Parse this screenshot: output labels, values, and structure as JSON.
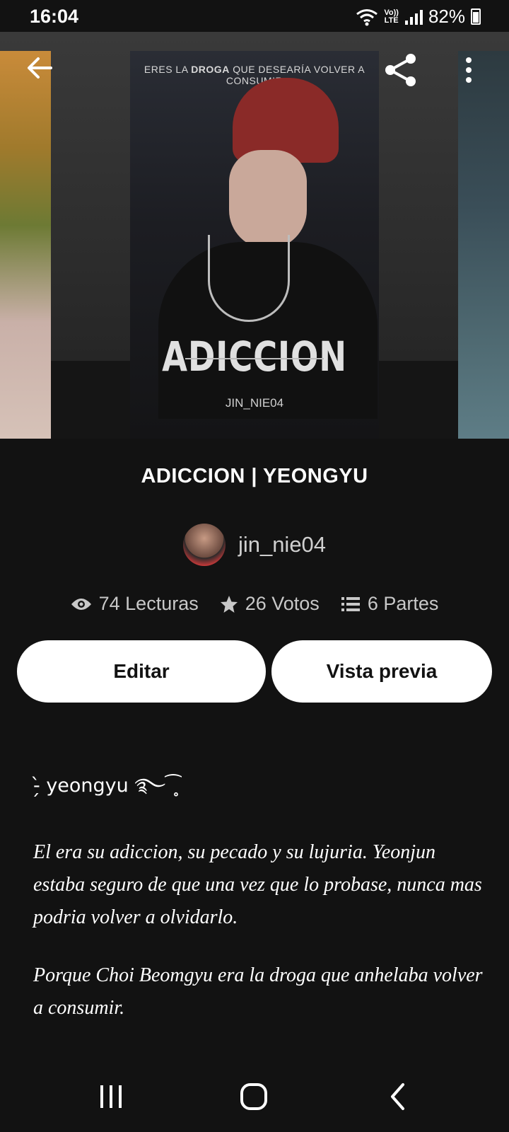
{
  "status_bar": {
    "time": "16:04",
    "network_top": "Vo))",
    "network_bottom": "LTE",
    "battery": "82%"
  },
  "cover": {
    "tagline_prefix": "ERES LA ",
    "tagline_bold": "DROGA",
    "tagline_suffix": " QUE DESEARÍA VOLVER A CONSUMIR",
    "title": "ADICCION",
    "author": "JIN_NIE04"
  },
  "story": {
    "title": "ADICCION | YEONGYU",
    "author": "jin_nie04"
  },
  "stats": {
    "reads": "74 Lecturas",
    "votes": "26 Votos",
    "parts": "6 Partes"
  },
  "actions": {
    "edit_label": "Editar",
    "preview_label": "Vista previa"
  },
  "description": {
    "tag": "-̗̀ yeongyu ࿐⁀̥",
    "p1": "El era su adiccion, su pecado y su lujuria. Yeonjun estaba seguro de que una vez que lo probase, nunca mas podria volver a olvidarlo.",
    "p2": "Porque Choi Beomgyu era la droga que anhelaba volver a consumir."
  },
  "icons": {
    "back": "arrow-left-icon",
    "share": "share-icon",
    "more": "more-vert-icon",
    "reads": "eye-icon",
    "votes": "star-icon",
    "parts": "list-icon"
  }
}
